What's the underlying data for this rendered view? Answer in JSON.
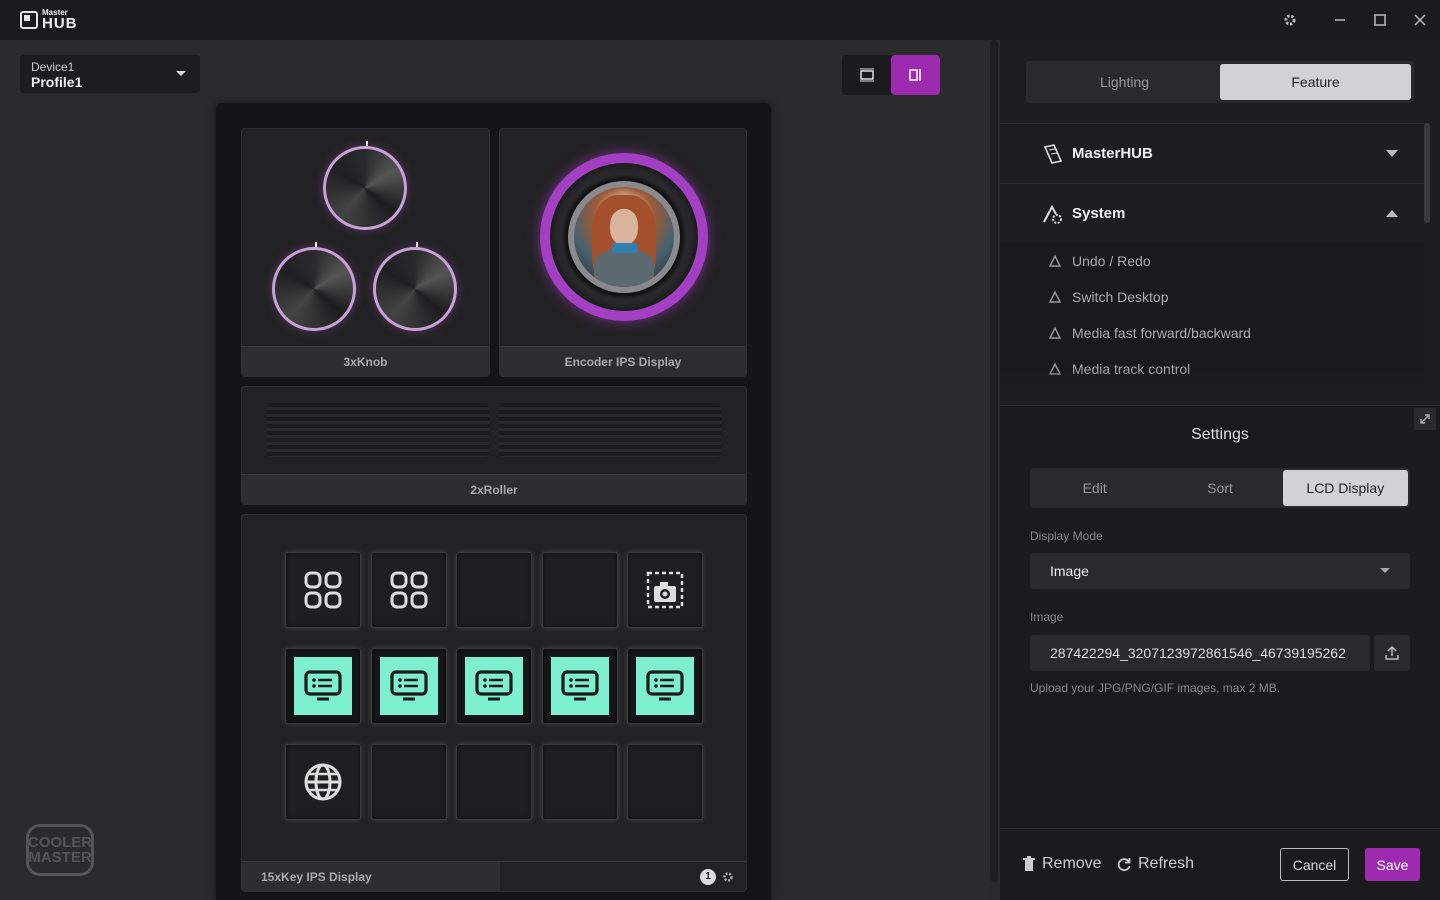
{
  "app": {
    "logo_small": "Master",
    "logo_big": "HUB"
  },
  "device_select": {
    "device": "Device1",
    "profile": "Profile1"
  },
  "modules": {
    "knob_label": "3xKnob",
    "encoder_label": "Encoder IPS Display",
    "roller_label": "2xRoller",
    "keys_label": "15xKey IPS Display",
    "keys_page": "1"
  },
  "keys": [
    {
      "icon": "grid-apps-icon",
      "style": "plain"
    },
    {
      "icon": "grid-apps-icon",
      "style": "plain"
    },
    {
      "icon": "",
      "style": "plain"
    },
    {
      "icon": "",
      "style": "plain"
    },
    {
      "icon": "screenshot-camera-icon",
      "style": "plain"
    },
    {
      "icon": "display-icon",
      "style": "teal"
    },
    {
      "icon": "display-icon",
      "style": "teal"
    },
    {
      "icon": "display-icon",
      "style": "teal"
    },
    {
      "icon": "display-icon",
      "style": "teal"
    },
    {
      "icon": "display-icon",
      "style": "teal"
    },
    {
      "icon": "globe-icon",
      "style": "plain"
    },
    {
      "icon": "",
      "style": "plain"
    },
    {
      "icon": "",
      "style": "plain"
    },
    {
      "icon": "",
      "style": "plain"
    },
    {
      "icon": "",
      "style": "plain"
    }
  ],
  "brand": {
    "line1": "COOLER",
    "line2": "MASTER"
  },
  "panel": {
    "tabs": [
      "Lighting",
      "Feature"
    ],
    "active_tab": "Feature",
    "categories": [
      {
        "label": "MasterHUB",
        "expanded": false
      },
      {
        "label": "System",
        "expanded": true
      }
    ],
    "system_items": [
      "Undo / Redo",
      "Switch Desktop",
      "Media fast forward/backward",
      "Media track control"
    ]
  },
  "settings": {
    "title": "Settings",
    "tabs": [
      "Edit",
      "Sort",
      "LCD Display"
    ],
    "active_tab": "LCD Display",
    "display_mode_label": "Display Mode",
    "display_mode_value": "Image",
    "image_label": "Image",
    "image_value": "287422294_3207123972861546_46739195262",
    "hint": "Upload your JPG/PNG/GIF images, max 2 MB."
  },
  "actions": {
    "remove": "Remove",
    "refresh": "Refresh",
    "cancel": "Cancel",
    "save": "Save"
  },
  "colors": {
    "accent": "#9c2bb0",
    "key_teal": "#7ef0cf"
  }
}
